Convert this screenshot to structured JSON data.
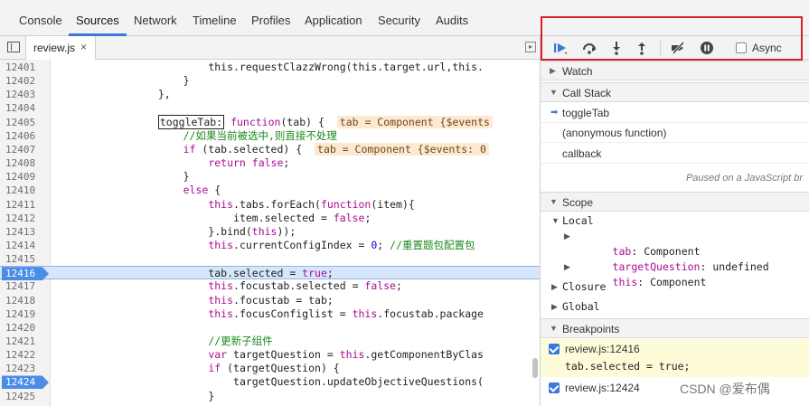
{
  "top_tabs": [
    {
      "label": "Console",
      "active": false
    },
    {
      "label": "Sources",
      "active": true
    },
    {
      "label": "Network",
      "active": false
    },
    {
      "label": "Timeline",
      "active": false
    },
    {
      "label": "Profiles",
      "active": false
    },
    {
      "label": "Application",
      "active": false
    },
    {
      "label": "Security",
      "active": false
    },
    {
      "label": "Audits",
      "active": false
    }
  ],
  "editor": {
    "file_tab": "review.js",
    "close_glyph": "×",
    "right_toggle_glyph": "▸",
    "lines": [
      {
        "n": "12401",
        "indent": 24,
        "parts": [
          [
            "this.requestClazzWrong(this.target.url,this.",
            ""
          ]
        ]
      },
      {
        "n": "12402",
        "indent": 20,
        "parts": [
          [
            "}",
            ""
          ]
        ]
      },
      {
        "n": "12403",
        "indent": 16,
        "parts": [
          [
            "},",
            ""
          ]
        ]
      },
      {
        "n": "12404",
        "indent": 0,
        "parts": []
      },
      {
        "n": "12405",
        "indent": 16,
        "parts": [
          [
            "toggleTab:",
            "boxed"
          ],
          [
            " ",
            ""
          ],
          [
            "function",
            "kw"
          ],
          [
            "(tab) {  ",
            ""
          ],
          [
            "tab = Component {$events",
            "inline-val"
          ]
        ]
      },
      {
        "n": "12406",
        "indent": 20,
        "parts": [
          [
            "//如果当前被选中,则直接不处理",
            "cm"
          ]
        ]
      },
      {
        "n": "12407",
        "indent": 20,
        "parts": [
          [
            "if",
            "kw"
          ],
          [
            " (tab.selected) {  ",
            ""
          ],
          [
            "tab = Component {$events: 0",
            "inline-val"
          ]
        ]
      },
      {
        "n": "12408",
        "indent": 24,
        "parts": [
          [
            "return",
            "kw"
          ],
          [
            " ",
            ""
          ],
          [
            "false",
            "kw"
          ],
          [
            ";",
            ""
          ]
        ]
      },
      {
        "n": "12409",
        "indent": 20,
        "parts": [
          [
            "}",
            ""
          ]
        ]
      },
      {
        "n": "12410",
        "indent": 20,
        "parts": [
          [
            "else",
            "kw"
          ],
          [
            " {",
            ""
          ]
        ]
      },
      {
        "n": "12411",
        "indent": 24,
        "parts": [
          [
            "this",
            "kw"
          ],
          [
            ".tabs.forEach(",
            ""
          ],
          [
            "function",
            "kw"
          ],
          [
            "(item){",
            ""
          ]
        ]
      },
      {
        "n": "12412",
        "indent": 28,
        "parts": [
          [
            "item.selected = ",
            ""
          ],
          [
            "false",
            "kw"
          ],
          [
            ";",
            ""
          ]
        ]
      },
      {
        "n": "12413",
        "indent": 24,
        "parts": [
          [
            "}.bind(",
            ""
          ],
          [
            "this",
            "kw"
          ],
          [
            "));",
            ""
          ]
        ]
      },
      {
        "n": "12414",
        "indent": 24,
        "parts": [
          [
            "this",
            "kw"
          ],
          [
            ".currentConfigIndex = ",
            ""
          ],
          [
            "0",
            "num"
          ],
          [
            "; ",
            ""
          ],
          [
            "//重置题包配置包",
            "cm"
          ]
        ]
      },
      {
        "n": "12415",
        "indent": 0,
        "parts": []
      },
      {
        "n": "12416",
        "indent": 24,
        "breakpoint": true,
        "highlight": true,
        "parts": [
          [
            "tab.selected = ",
            ""
          ],
          [
            "true",
            "kw"
          ],
          [
            ";",
            ""
          ]
        ]
      },
      {
        "n": "12417",
        "indent": 24,
        "parts": [
          [
            "this",
            "kw"
          ],
          [
            ".focustab.selected = ",
            ""
          ],
          [
            "false",
            "kw"
          ],
          [
            ";",
            ""
          ]
        ]
      },
      {
        "n": "12418",
        "indent": 24,
        "parts": [
          [
            "this",
            "kw"
          ],
          [
            ".focustab = tab;",
            ""
          ]
        ]
      },
      {
        "n": "12419",
        "indent": 24,
        "parts": [
          [
            "this",
            "kw"
          ],
          [
            ".focusConfiglist = ",
            ""
          ],
          [
            "this",
            "kw"
          ],
          [
            ".focustab.package",
            ""
          ]
        ]
      },
      {
        "n": "12420",
        "indent": 0,
        "parts": []
      },
      {
        "n": "12421",
        "indent": 24,
        "parts": [
          [
            "//更新子组件",
            "cm"
          ]
        ]
      },
      {
        "n": "12422",
        "indent": 24,
        "parts": [
          [
            "var",
            "kw"
          ],
          [
            " targetQuestion = ",
            ""
          ],
          [
            "this",
            "kw"
          ],
          [
            ".getComponentByClas",
            ""
          ]
        ]
      },
      {
        "n": "12423",
        "indent": 24,
        "parts": [
          [
            "if",
            "kw"
          ],
          [
            " (targetQuestion) {",
            ""
          ]
        ]
      },
      {
        "n": "12424",
        "indent": 28,
        "breakpoint": true,
        "parts": [
          [
            "targetQuestion.updateObjectiveQuestions(",
            ""
          ]
        ]
      },
      {
        "n": "12425",
        "indent": 24,
        "parts": [
          [
            "}",
            ""
          ]
        ]
      }
    ]
  },
  "debugger": {
    "toolbar": {
      "resume": "resume-icon",
      "step_over": "step-over-icon",
      "step_into": "step-into-icon",
      "step_out": "step-out-icon",
      "deactivate": "deactivate-breakpoints-icon",
      "pause_exceptions": "pause-on-exceptions-icon",
      "async_label": "Async"
    },
    "watch": {
      "title": "Watch"
    },
    "call_stack": {
      "title": "Call Stack",
      "frames": [
        {
          "label": "toggleTab",
          "current": true
        },
        {
          "label": "(anonymous function)",
          "current": false
        },
        {
          "label": "callback",
          "current": false
        }
      ],
      "paused_message": "Paused on a JavaScript br"
    },
    "scope": {
      "title": "Scope",
      "local_label": "Local",
      "tab_name": "tab",
      "tab_value": "Component",
      "tq_name": "targetQuestion",
      "tq_value": "undefined",
      "this_name": "this",
      "this_value": "Component",
      "closure_label": "Closure",
      "global_label": "Global"
    },
    "breakpoints": {
      "title": "Breakpoints",
      "items": [
        {
          "file": "review.js:12416",
          "code": "tab.selected = true;"
        },
        {
          "file": "review.js:12424",
          "code": ""
        }
      ]
    }
  },
  "colors": {
    "accent": "#3879d9",
    "annotation_frame": "#d3202a",
    "breakpoint_row": "#fdfbd8"
  },
  "watermark": "CSDN @爱布偶"
}
